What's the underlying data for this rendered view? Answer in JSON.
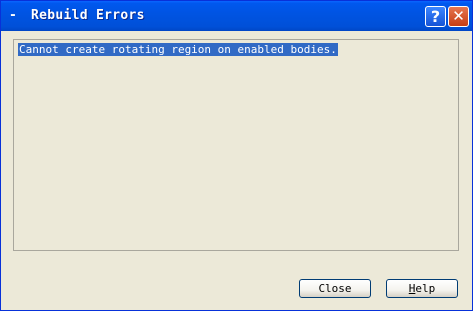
{
  "window": {
    "title": "Rebuild Errors",
    "title_prefix": "-",
    "help_glyph": "?",
    "close_glyph": "✕"
  },
  "errors": {
    "message": "Cannot create rotating region on enabled bodies."
  },
  "buttons": {
    "close_label": "Close",
    "help_label_first": "H",
    "help_label_rest": "elp"
  },
  "colors": {
    "titlebar": "#0054e3",
    "selection": "#316ac5",
    "face": "#ece9d8",
    "close_button": "#c63d13"
  }
}
